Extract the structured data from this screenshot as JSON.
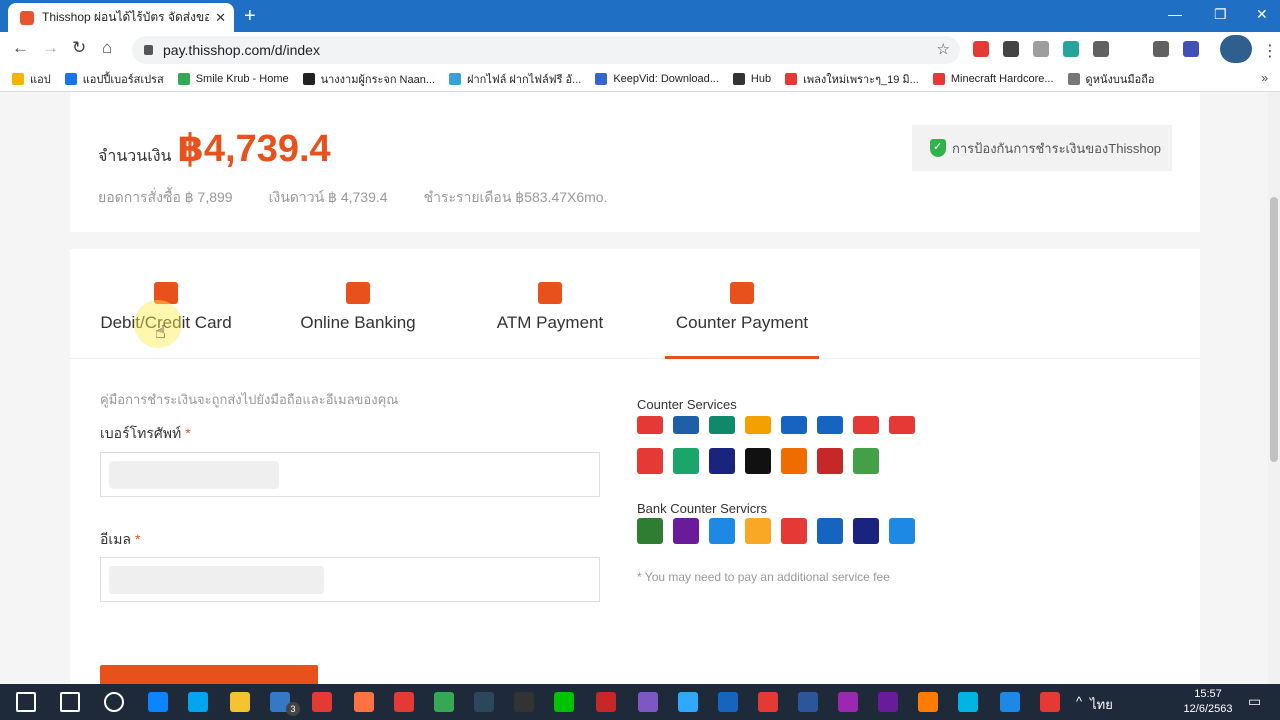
{
  "browser": {
    "tab_title": "Thisshop ผ่อนได้ไร้บัตร จัดส่งของเร็วทั่วไทย",
    "tab_close": "✕",
    "new_tab": "+",
    "win_min": "—",
    "win_max": "❐",
    "win_close": "✕",
    "back": "←",
    "forward": "→",
    "reload": "↻",
    "home": "⌂",
    "url": "pay.thisshop.com/d/index",
    "star": "☆",
    "kebab": "⋮"
  },
  "bookmarks": [
    {
      "label": "แอป",
      "color": "#f4b400"
    },
    {
      "label": "แอปปี้เบอร์สเปรส",
      "color": "#1a73e8"
    },
    {
      "label": "Smile Krub - Home",
      "color": "#34a853"
    },
    {
      "label": "นางงามผู้กระจก Naan...",
      "color": "#222222"
    },
    {
      "label": "ฝากไฟล์ ฝากไฟล์ฟรี อั...",
      "color": "#3aa0d8"
    },
    {
      "label": "KeepVid: Download...",
      "color": "#3366cc"
    },
    {
      "label": "Hub",
      "color": "#333333"
    },
    {
      "label": "เพลงใหม่เพราะๆ_19 มิ...",
      "color": "#e53935"
    },
    {
      "label": "Minecraft Hardcore...",
      "color": "#e53935"
    },
    {
      "label": "ดูหนังบนมือถือ",
      "color": "#777777"
    }
  ],
  "bookmarks_more": "»",
  "extensions_colors": [
    "#e53935",
    "#444444",
    "#9e9e9e",
    "#26a69a",
    "#616161",
    "#616161",
    "#3f51b5"
  ],
  "summary": {
    "amount_label": "จำนวนเงิน",
    "amount_value": "฿4,739.4",
    "order_total": "ยอดการสั่งซื้อ ฿ 7,899",
    "down_payment": "เงินดาวน์ ฿ 4,739.4",
    "monthly": "ชำระรายเดือน ฿583.47X6mo.",
    "protection": "การป้องกันการชำระเงินของThisshop"
  },
  "payment_tabs": [
    {
      "label": "Debit/Credit Card",
      "icon": "credit-card-icon",
      "active": false
    },
    {
      "label": "Online Banking",
      "icon": "online-banking-icon",
      "active": false
    },
    {
      "label": "ATM Payment",
      "icon": "atm-icon",
      "active": false
    },
    {
      "label": "Counter Payment",
      "icon": "counter-icon",
      "active": true
    }
  ],
  "form": {
    "hint": "คู่มือการชำระเงินจะถูกส่งไปยังมือถือและอีเมลของคุณ",
    "phone_label": "เบอร์โทรศัพท์",
    "email_label": "อีเมล",
    "required_mark": "*"
  },
  "counter_services": {
    "title": "Counter Services",
    "row1_colors": [
      "#e53935",
      "#1e5fa8",
      "#0e8a6b",
      "#f4a000",
      "#1565c0",
      "#1565c0",
      "#e53935",
      "#e53935"
    ],
    "row2_colors": [
      "#e53935",
      "#1aa56a",
      "#1a237e",
      "#111111",
      "#ef6c00",
      "#c62828",
      "#43a047"
    ]
  },
  "bank_counter": {
    "title": "Bank Counter Servicrs",
    "colors": [
      "#2e7d32",
      "#6a1b9a",
      "#1e88e5",
      "#f9a825",
      "#e53935",
      "#1565c0",
      "#1a237e",
      "#1e88e5"
    ]
  },
  "fee_note": "* You may need to pay an additional service fee",
  "taskbar": {
    "icon_colors": [
      "#ffffff",
      "#ffffff",
      "#ffffff",
      "#0a84ff",
      "#00a4ef",
      "#f4c430",
      "#3478c6",
      "#e53935",
      "#ff7043",
      "#e53935",
      "#34a853",
      "#2a475e",
      "#333333",
      "#00c300",
      "#c62828",
      "#7e57c2",
      "#31a8ff",
      "#1565c0",
      "#e53935",
      "#2b579a",
      "#9c27b0",
      "#6a1b9a",
      "#ff7c00",
      "#00b3e3",
      "#1e88e5",
      "#e53935"
    ],
    "mail_badge": "3",
    "lang": "ไทย",
    "time": "15:57",
    "date": "12/6/2563",
    "tray_up": "^",
    "notify": "▭"
  }
}
